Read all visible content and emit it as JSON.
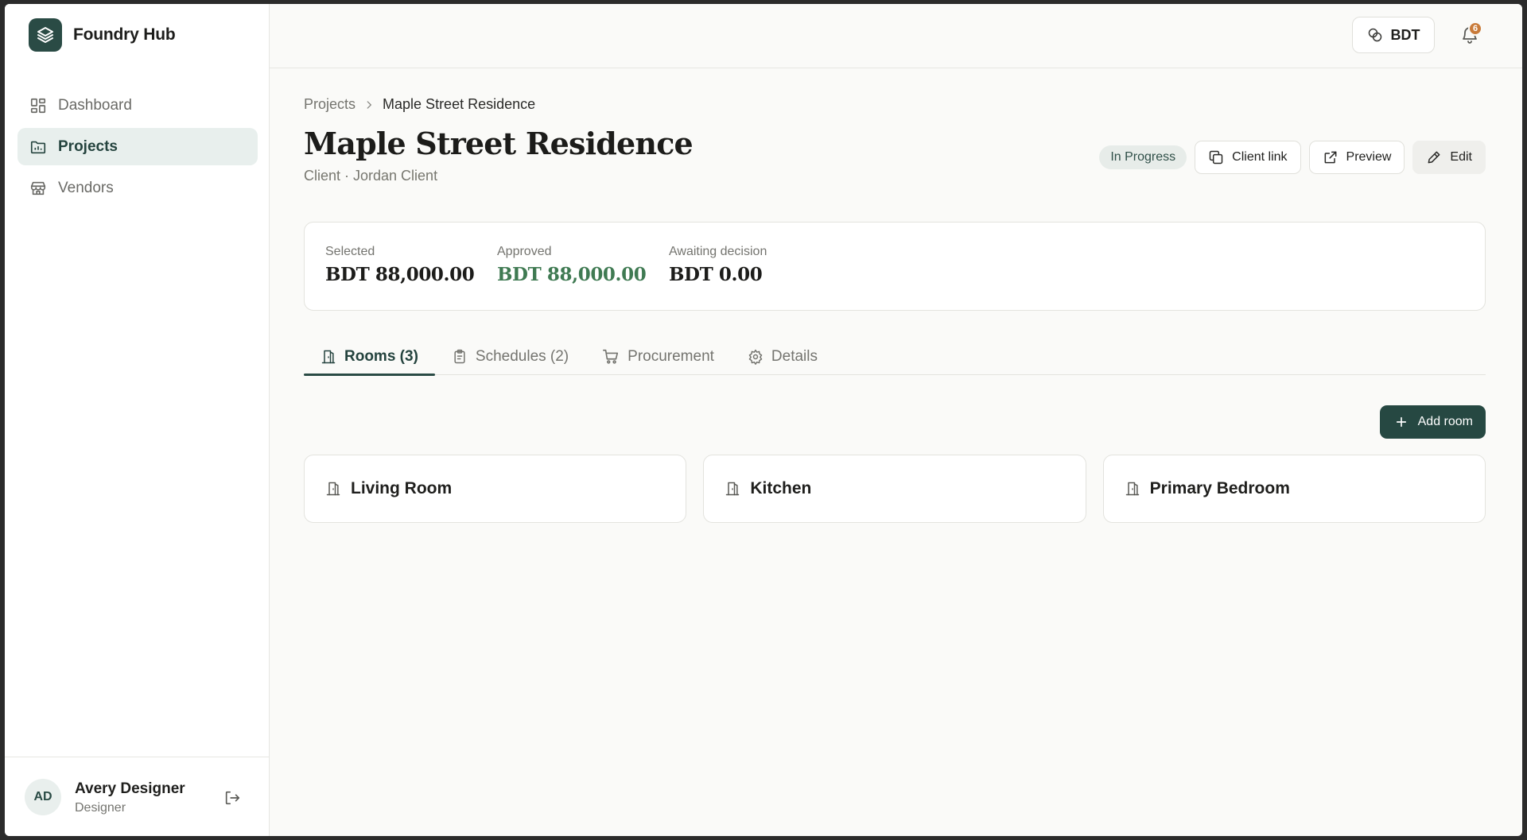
{
  "app": {
    "name": "Foundry Hub"
  },
  "sidebar": {
    "items": [
      {
        "label": "Dashboard",
        "icon": "dashboard-icon",
        "active": false
      },
      {
        "label": "Projects",
        "icon": "folder-icon",
        "active": true
      },
      {
        "label": "Vendors",
        "icon": "store-icon",
        "active": false
      }
    ]
  },
  "user": {
    "initials": "AD",
    "name": "Avery Designer",
    "role": "Designer"
  },
  "topbar": {
    "currency": "BDT",
    "notification_count": "6"
  },
  "breadcrumb": {
    "parent": "Projects",
    "current": "Maple Street Residence"
  },
  "project": {
    "title": "Maple Street Residence",
    "subtitle": "Client · Jordan Client",
    "status": "In Progress"
  },
  "actions": {
    "client_link": "Client link",
    "preview": "Preview",
    "edit": "Edit"
  },
  "summary": {
    "selected_label": "Selected",
    "selected_value": "BDT 88,000.00",
    "approved_label": "Approved",
    "approved_value": "BDT 88,000.00",
    "awaiting_label": "Awaiting decision",
    "awaiting_value": "BDT 0.00"
  },
  "tabs": [
    {
      "label": "Rooms (3)",
      "active": true
    },
    {
      "label": "Schedules (2)",
      "active": false
    },
    {
      "label": "Procurement",
      "active": false
    },
    {
      "label": "Details",
      "active": false
    }
  ],
  "rooms_section": {
    "add_label": "Add room"
  },
  "rooms": [
    {
      "name": "Living Room"
    },
    {
      "name": "Kitchen"
    },
    {
      "name": "Primary Bedroom"
    }
  ],
  "colors": {
    "brand": "#2a4b45",
    "approved": "#3f7a52",
    "badge": "#c97b3a"
  }
}
